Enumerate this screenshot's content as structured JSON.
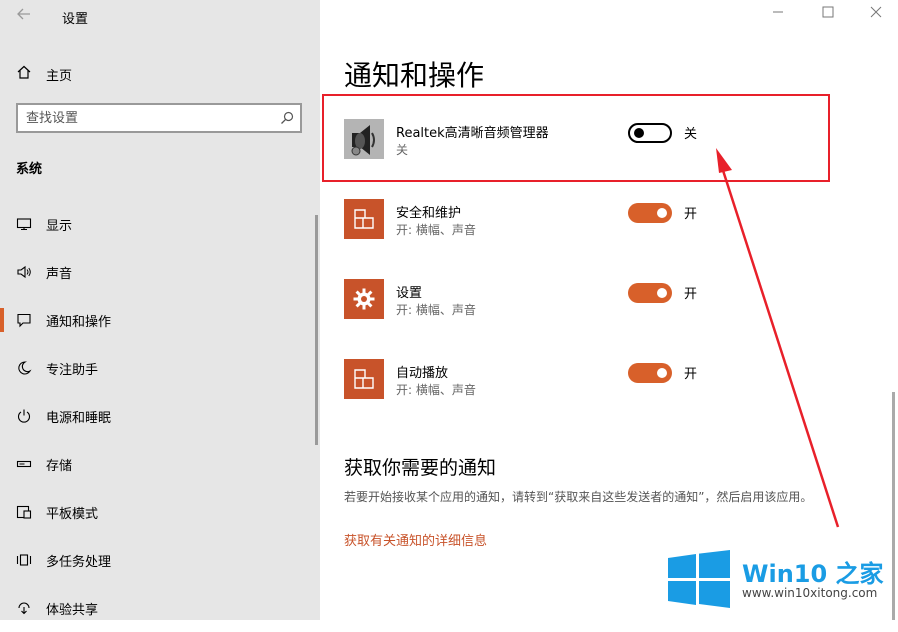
{
  "window": {
    "title": "设置",
    "back_icon": "back-arrow-icon",
    "controls": [
      "minimize-icon",
      "maximize-icon",
      "close-icon"
    ]
  },
  "sidebar": {
    "home_label": "主页",
    "search": {
      "placeholder": "查找设置",
      "value": ""
    },
    "section_title": "系统",
    "items": [
      {
        "label": "显示",
        "icon": "display-icon",
        "active": false
      },
      {
        "label": "声音",
        "icon": "speaker-icon",
        "active": false
      },
      {
        "label": "通知和操作",
        "icon": "notification-icon",
        "active": true
      },
      {
        "label": "专注助手",
        "icon": "moon-icon",
        "active": false
      },
      {
        "label": "电源和睡眠",
        "icon": "power-icon",
        "active": false
      },
      {
        "label": "存储",
        "icon": "storage-icon",
        "active": false
      },
      {
        "label": "平板模式",
        "icon": "tablet-icon",
        "active": false
      },
      {
        "label": "多任务处理",
        "icon": "multitask-icon",
        "active": false
      },
      {
        "label": "体验共享",
        "icon": "share-icon",
        "active": false
      }
    ]
  },
  "main": {
    "title": "通知和操作",
    "apps": [
      {
        "name": "Realtek高清晰音频管理器",
        "sub": "关",
        "toggle_on": false,
        "state": "关",
        "icon": "speaker-app-icon"
      },
      {
        "name": "安全和维护",
        "sub": "开: 横幅、声音",
        "toggle_on": true,
        "state": "开",
        "icon": "security-maintenance-icon"
      },
      {
        "name": "设置",
        "sub": "开: 横幅、声音",
        "toggle_on": true,
        "state": "开",
        "icon": "settings-gear-icon"
      },
      {
        "name": "自动播放",
        "sub": "开: 横幅、声音",
        "toggle_on": true,
        "state": "开",
        "icon": "autoplay-icon"
      }
    ],
    "section_title": "获取你需要的通知",
    "description": "若要开始接收某个应用的通知，请转到“获取来自这些发送者的通知”，然后启用该应用。",
    "link": "获取有关通知的详细信息"
  },
  "watermark": {
    "brand_prefix": "Win10",
    "brand_suffix": "之家",
    "url": "www.win10xitong.com"
  },
  "colors": {
    "accent": "#d8602a",
    "highlight": "#e8202a",
    "watermark": "#1a9ce4"
  }
}
